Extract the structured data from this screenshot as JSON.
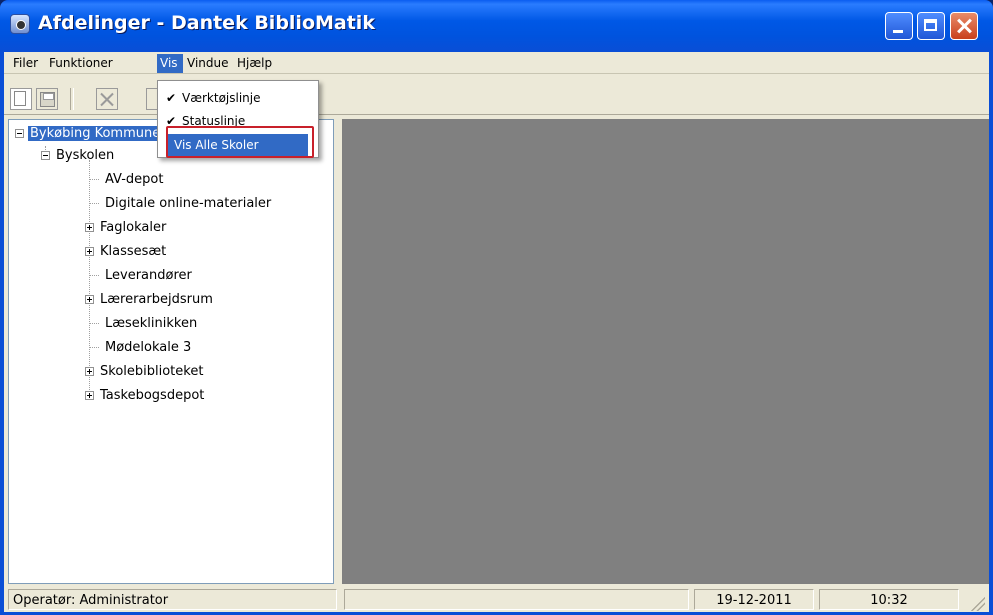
{
  "window": {
    "title": "Afdelinger - Dantek BiblioMatik"
  },
  "menubar": {
    "items": [
      "Filer",
      "Funktioner",
      "Vis",
      "Vindue",
      "Hjælp"
    ],
    "active": "Vis"
  },
  "vis_menu": {
    "items": [
      {
        "label": "Værktøjslinje",
        "checked": true
      },
      {
        "label": "Statuslinje",
        "checked": true
      },
      {
        "label": "Vis Alle Skoler",
        "checked": false,
        "highlighted": true
      }
    ]
  },
  "tree": {
    "root": "Bykøbing Kommune",
    "school": "Byskolen",
    "children": [
      {
        "label": "AV-depot",
        "expandable": false
      },
      {
        "label": "Digitale online-materialer",
        "expandable": false
      },
      {
        "label": "Faglokaler",
        "expandable": true
      },
      {
        "label": "Klassesæt",
        "expandable": true
      },
      {
        "label": "Leverandører",
        "expandable": false
      },
      {
        "label": "Lærerarbejdsrum",
        "expandable": true
      },
      {
        "label": "Læseklinikken",
        "expandable": false
      },
      {
        "label": "Mødelokale 3",
        "expandable": false
      },
      {
        "label": "Skolebiblioteket",
        "expandable": true
      },
      {
        "label": "Taskebogsdepot",
        "expandable": true
      }
    ]
  },
  "statusbar": {
    "operator": "Operatør: Administrator",
    "date": "19-12-2011",
    "time": "10:32"
  },
  "colors": {
    "titlebar": "#0054e3",
    "selection": "#316ac5",
    "pane_gray": "#808080",
    "highlight_box": "#c8202a"
  }
}
